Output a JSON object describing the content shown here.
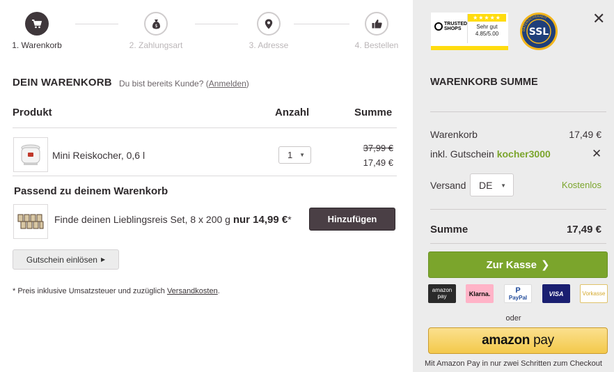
{
  "steps": [
    {
      "label": "1. Warenkorb",
      "icon": "cart-icon"
    },
    {
      "label": "2. Zahlungsart",
      "icon": "money-bag-icon"
    },
    {
      "label": "3. Adresse",
      "icon": "location-pin-icon"
    },
    {
      "label": "4. Bestellen",
      "icon": "thumbs-up-icon"
    }
  ],
  "cart": {
    "title": "DEIN WARENKORB",
    "login_prefix": "Du bist bereits Kunde? (",
    "login_link": "Anmelden",
    "login_suffix": ")",
    "headers": {
      "product": "Produkt",
      "quantity": "Anzahl",
      "sum": "Summe"
    },
    "items": [
      {
        "name": "Mini Reiskocher, 0,6 l",
        "quantity": "1",
        "price_old": "37,99 €",
        "price_new": "17,49 €"
      }
    ]
  },
  "suggestion": {
    "title": "Passend zu deinem Warenkorb",
    "text": "Finde deinen Lieblingsreis Set, 8 x 200 g",
    "price": "nur 14,99 €",
    "asterisk": "*",
    "button": "Hinzufügen"
  },
  "coupon_button": "Gutschein einlösen",
  "footnote": {
    "text": "* Preis inklusive Umsatzsteuer und zuzüglich",
    "link": "Versandkosten",
    "end": "."
  },
  "summary": {
    "trusted": {
      "brand": "TRUSTED SHOPS",
      "stars": "★★★★★",
      "rating_text": "Sehr gut",
      "rating": "4.85/5.00"
    },
    "ssl": {
      "text": "SSL",
      "ring_text": "DATENSICHERHEIT"
    },
    "title": "WARENKORB SUMME",
    "cart_label": "Warenkorb",
    "cart_value": "17,49 €",
    "voucher_label": "inkl. Gutschein",
    "voucher_code": "kocher3000",
    "shipping_label": "Versand",
    "shipping_country": "DE",
    "shipping_value": "Kostenlos",
    "total_label": "Summe",
    "total_value": "17,49 €",
    "checkout_button": "Zur Kasse",
    "payment_methods": {
      "amazon_line1": "amazon",
      "amazon_line2": "pay",
      "klarna": "Klarna.",
      "paypal": "PayPal",
      "visa": "VISA",
      "vorkasse": "Vorkasse"
    },
    "or": "oder",
    "amazon_button_brand": "amazon",
    "amazon_button_pay": "pay",
    "amazon_note": "Mit Amazon Pay in nur zwei Schritten zum Checkout"
  },
  "colors": {
    "accent_green": "#7ba52c",
    "dark_button": "#4a3f45",
    "amazon_yellow": "#f3c94b",
    "trusted_yellow": "#ffdc0f"
  }
}
